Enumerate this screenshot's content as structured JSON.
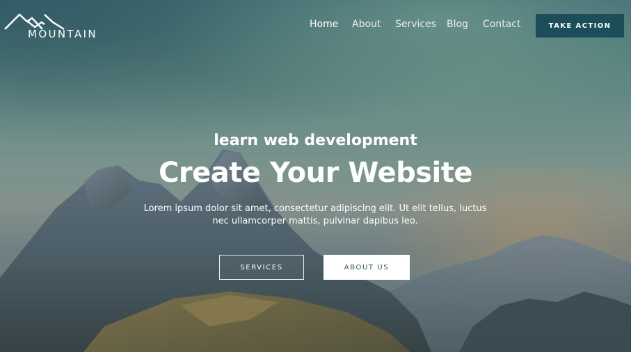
{
  "brand": {
    "name": "MOUNTAIN",
    "logo_icon": "mountain-peaks-icon"
  },
  "nav": {
    "items": [
      {
        "label": "Home",
        "active": true
      },
      {
        "label": "About",
        "active": false
      },
      {
        "label": "Services",
        "active": false
      },
      {
        "label": "Blog",
        "active": false
      },
      {
        "label": "Contact",
        "active": false
      }
    ],
    "cta_label": "TAKE ACTION"
  },
  "hero": {
    "kicker": "learn web development",
    "title": "Create Your Website",
    "description": "Lorem ipsum dolor sit amet, consectetur adipiscing elit. Ut elit tellus, luctus nec ullamcorper mattis, pulvinar dapibus leo.",
    "buttons": {
      "services_label": "SERVICES",
      "about_label": "ABOUT US"
    }
  },
  "colors": {
    "cta_background": "#1c4e5a",
    "text": "#ffffff",
    "about_button_text": "#2f5561"
  }
}
